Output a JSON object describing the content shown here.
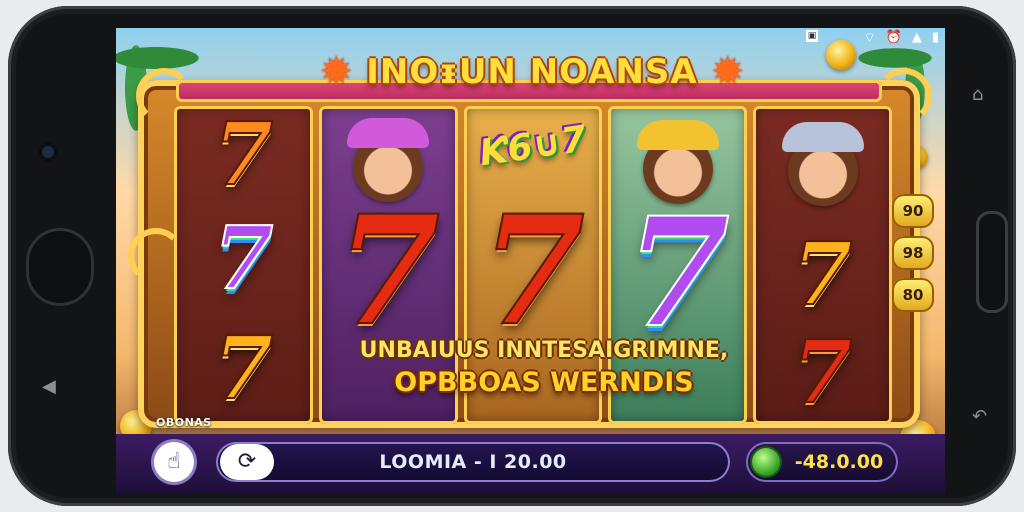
{
  "game": {
    "title": "INOᵻUN NOANSA",
    "banner_line1": "UNBAIUUS INNTESAIGRIMINE,",
    "banner_line2": "OPBBOAS WERNDIS",
    "bonus_label": "OBONAS"
  },
  "reels": [
    {
      "symbols": [
        "7",
        "7",
        "7"
      ]
    },
    {
      "symbols": [
        "avatar-pink",
        "7"
      ]
    },
    {
      "logo": "Ƙ6∪7",
      "symbols": [
        "7"
      ]
    },
    {
      "symbols": [
        "avatar-gold",
        "7"
      ]
    },
    {
      "symbols": [
        "avatar-helmet",
        "7",
        "7"
      ]
    }
  ],
  "multipliers": [
    "90",
    "98",
    "80"
  ],
  "controls": {
    "bet_label": "LOOMIA - I 20.00",
    "balance": "-48.0.00",
    "spin_icon": "refresh-icon",
    "left_button_icon": "hand-icon"
  },
  "colors": {
    "accent_gold": "#ffd35c",
    "title_yellow": "#ffdf3d",
    "bar_purple": "#2a174f",
    "balance_yellow": "#ffe14a"
  }
}
